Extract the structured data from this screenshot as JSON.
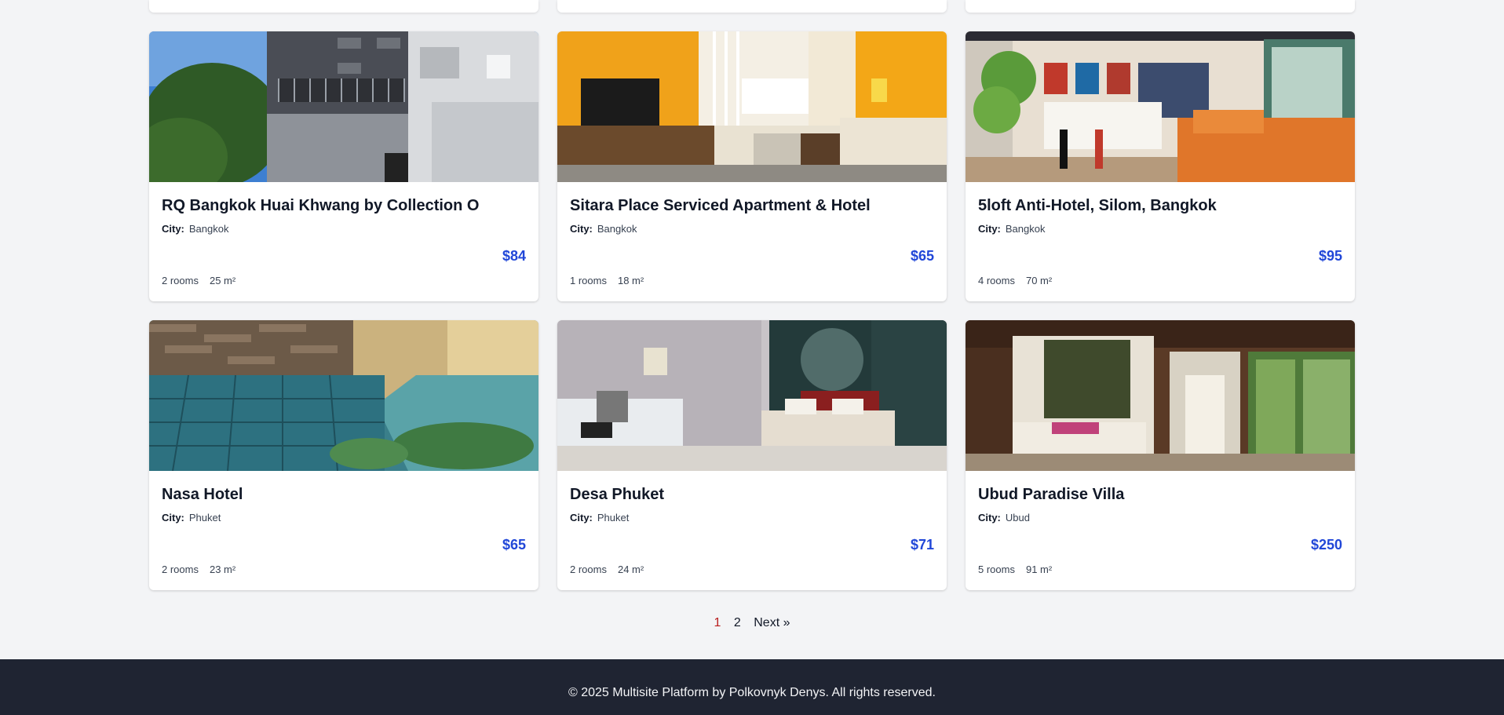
{
  "hotels": [
    {
      "name": "RQ Bangkok Huai Khwang by Collection O",
      "city_label": "City:",
      "city": "Bangkok",
      "price": "$84",
      "rooms": "2 rooms",
      "area": "25 m²",
      "image": "building-exterior"
    },
    {
      "name": "Sitara Place Serviced Apartment & Hotel",
      "city_label": "City:",
      "city": "Bangkok",
      "price": "$65",
      "rooms": "1 rooms",
      "area": "18 m²",
      "image": "apartment-room"
    },
    {
      "name": "5loft Anti-Hotel, Silom, Bangkok",
      "city_label": "City:",
      "city": "Bangkok",
      "price": "$95",
      "rooms": "4 rooms",
      "area": "70 m²",
      "image": "loft-living-room"
    },
    {
      "name": "Nasa Hotel",
      "city_label": "City:",
      "city": "Phuket",
      "price": "$65",
      "rooms": "2 rooms",
      "area": "23 m²",
      "image": "pool"
    },
    {
      "name": "Desa Phuket",
      "city_label": "City:",
      "city": "Phuket",
      "price": "$71",
      "rooms": "2 rooms",
      "area": "24 m²",
      "image": "hotel-bedroom"
    },
    {
      "name": "Ubud Paradise Villa",
      "city_label": "City:",
      "city": "Ubud",
      "price": "$250",
      "rooms": "5 rooms",
      "area": "91 m²",
      "image": "villa-canopy-bed"
    }
  ],
  "pagination": {
    "page1": "1",
    "page2": "2",
    "next": "Next »"
  },
  "footer": {
    "text": "© 2025 Multisite Platform by Polkovnyk Denys. All rights reserved."
  },
  "colors": {
    "price": "#2147d8",
    "active_page": "#b91c1c",
    "footer_bg": "#1f2432"
  }
}
